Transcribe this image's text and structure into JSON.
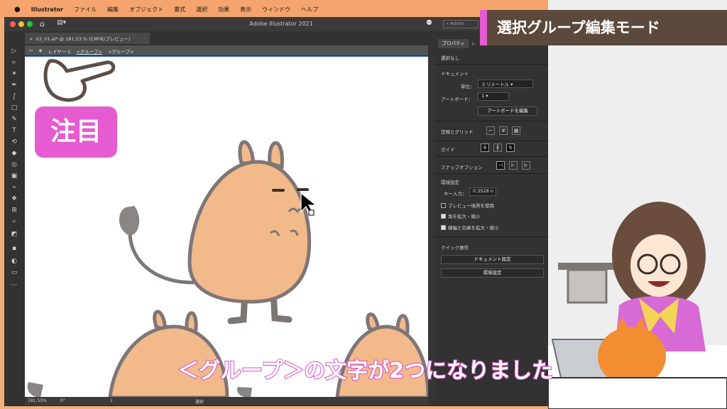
{
  "menubar": {
    "app": "Illustrator",
    "items": [
      "ファイル",
      "編集",
      "オブジェクト",
      "書式",
      "選択",
      "効果",
      "表示",
      "ウィンドウ",
      "ヘルプ"
    ]
  },
  "window": {
    "title": "Adobe Illustrator 2021",
    "doc_tab": "03_01.ai* @ 181.53 % (CMYK/プレビュー)",
    "search_placeholder": "Adobe"
  },
  "breadcrumb": {
    "layer": "レイヤー 1",
    "group1": "<グループ>",
    "group2": "<グループ>"
  },
  "status": {
    "zoom": "181.53%",
    "rotate": "0°",
    "artboard": "1",
    "mode": "選択"
  },
  "panel": {
    "tab_properties": "プロパティ",
    "tab_layers": "レ",
    "no_selection": "選択なし",
    "document_section": "ドキュメント",
    "unit_label": "単位：",
    "unit_value": "ミリメートル",
    "artboard_label": "アートボード：",
    "artboard_value": "1",
    "edit_artboard_button": "アートボードを編集",
    "ruler_grid": "定規とグリッド",
    "guides": "ガイド",
    "snap_options": "スナップオプション",
    "preferences": "環境設定",
    "key_input_label": "キー入力：",
    "key_input_value": "0.3528 n",
    "preview_bounds": "プレビュー境界を使用",
    "scale_corners": "角を拡大・縮小",
    "scale_strokes": "線幅と効果を拡大・縮小",
    "quick_actions": "クイック操作",
    "doc_setup_button": "ドキュメント設定",
    "prefs_button": "環境設定"
  },
  "overlay": {
    "title": "選択グループ編集モード",
    "badge": "注目",
    "caption": "＜グループ＞の文字が2つになりました"
  },
  "colors": {
    "menubar": "#f4a46c",
    "pink": "#e55bd0",
    "title_band": "#5b4a3c",
    "character": "#f2b98a",
    "outline": "#7e7676"
  },
  "icons": [
    "apple-logo-icon",
    "home-icon",
    "workspace-icon",
    "search-icon",
    "selection-tool-icon",
    "direct-selection-tool-icon",
    "pen-tool-icon",
    "rectangle-tool-icon",
    "type-tool-icon",
    "zoom-tool-icon",
    "pointing-hand-icon",
    "mouse-cursor-icon"
  ]
}
